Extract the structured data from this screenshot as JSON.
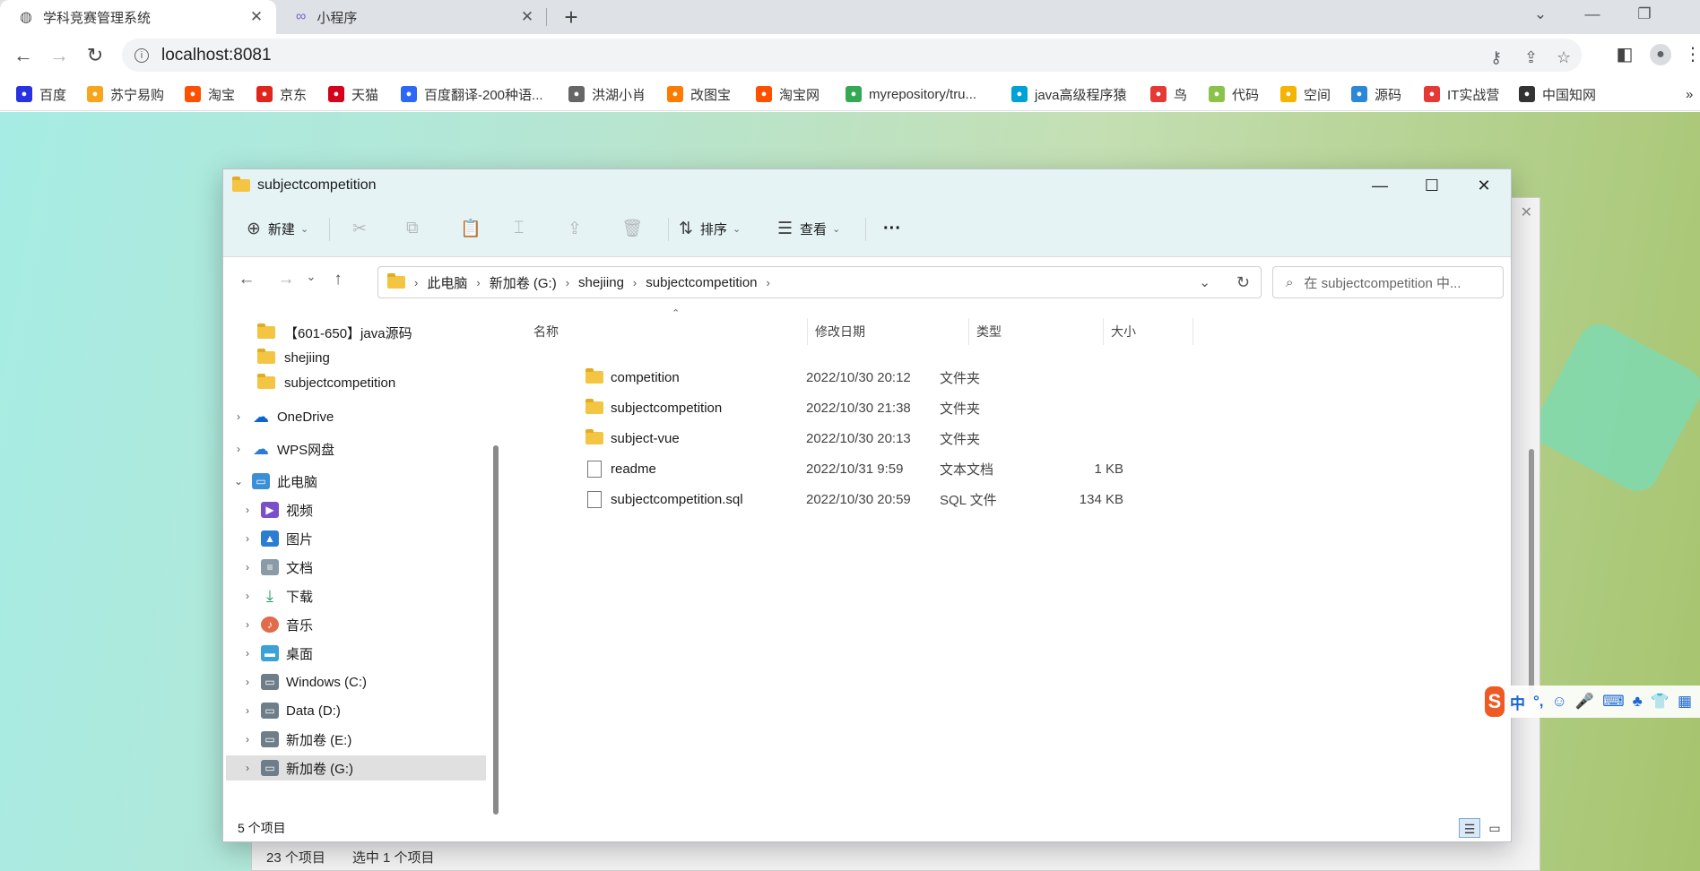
{
  "browser": {
    "tabs": [
      {
        "title": "学科竞赛管理系统",
        "active": true
      },
      {
        "title": "小程序",
        "active": false
      }
    ],
    "url": "localhost:8081",
    "bookmarks": [
      {
        "label": "百度",
        "color": "#2932e1"
      },
      {
        "label": "苏宁易购",
        "color": "#f8a51c"
      },
      {
        "label": "淘宝",
        "color": "#ff5000"
      },
      {
        "label": "京东",
        "color": "#e1251b"
      },
      {
        "label": "天猫",
        "color": "#d5001c"
      },
      {
        "label": "百度翻译-200种语...",
        "color": "#2c68f5"
      },
      {
        "label": "洪湖小肖",
        "color": "#666666"
      },
      {
        "label": "改图宝",
        "color": "#ff7a00"
      },
      {
        "label": "淘宝网",
        "color": "#ff5000"
      },
      {
        "label": "myrepository/tru...",
        "color": "#34a853"
      },
      {
        "label": "java高级程序猿",
        "color": "#00a1d6"
      },
      {
        "label": "鸟",
        "color": "#e53935"
      },
      {
        "label": "代码",
        "color": "#8bc34a"
      },
      {
        "label": "空间",
        "color": "#f4b400"
      },
      {
        "label": "源码",
        "color": "#2b88d8"
      },
      {
        "label": "IT实战营",
        "color": "#e53935"
      },
      {
        "label": "中国知网",
        "color": "#333333"
      }
    ],
    "more_glyph": "»"
  },
  "background_window": {
    "status_count": "23 个项目",
    "status_selected": "选中 1 个项目"
  },
  "explorer": {
    "title": "subjectcompetition",
    "toolbar": {
      "new_label": "新建",
      "sort_label": "排序",
      "view_label": "查看",
      "more_label": "···"
    },
    "breadcrumb": [
      "此电脑",
      "新加卷 (G:)",
      "shejiing",
      "subjectcompetition"
    ],
    "search_placeholder": "在 subjectcompetition 中...",
    "sidebar": {
      "quick": [
        {
          "label": "【601-650】java源码"
        },
        {
          "label": "shejiing"
        },
        {
          "label": "subjectcompetition"
        }
      ],
      "onedrive": "OneDrive",
      "wps": "WPS网盘",
      "thispc": "此电脑",
      "pc_children": [
        {
          "label": "视频",
          "color": "#7b4fc9"
        },
        {
          "label": "图片",
          "color": "#2b7cd3"
        },
        {
          "label": "文档",
          "color": "#8a9aa6"
        },
        {
          "label": "下载",
          "color": "#1e9e6a"
        },
        {
          "label": "音乐",
          "color": "#e06b4d"
        },
        {
          "label": "桌面",
          "color": "#3aa1d9"
        },
        {
          "label": "Windows (C:)",
          "color": "#6d7e8a"
        },
        {
          "label": "Data (D:)",
          "color": "#6d7e8a"
        },
        {
          "label": "新加卷 (E:)",
          "color": "#6d7e8a"
        },
        {
          "label": "新加卷 (G:)",
          "color": "#6d7e8a"
        }
      ]
    },
    "columns": {
      "name": "名称",
      "date": "修改日期",
      "type": "类型",
      "size": "大小"
    },
    "files": [
      {
        "name": "competition",
        "date": "2022/10/30 20:12",
        "type": "文件夹",
        "size": "",
        "kind": "folder"
      },
      {
        "name": "subjectcompetition",
        "date": "2022/10/30 21:38",
        "type": "文件夹",
        "size": "",
        "kind": "folder"
      },
      {
        "name": "subject-vue",
        "date": "2022/10/30 20:13",
        "type": "文件夹",
        "size": "",
        "kind": "folder"
      },
      {
        "name": "readme",
        "date": "2022/10/31 9:59",
        "type": "文本文档",
        "size": "1 KB",
        "kind": "doc"
      },
      {
        "name": "subjectcompetition.sql",
        "date": "2022/10/30 20:59",
        "type": "SQL 文件",
        "size": "134 KB",
        "kind": "doc"
      }
    ],
    "status": "5 个项目"
  },
  "ime": {
    "logo": "S",
    "items": [
      "中",
      "°,",
      "☺",
      "🎤",
      "⌨",
      "♣",
      "👕",
      "▦"
    ]
  }
}
